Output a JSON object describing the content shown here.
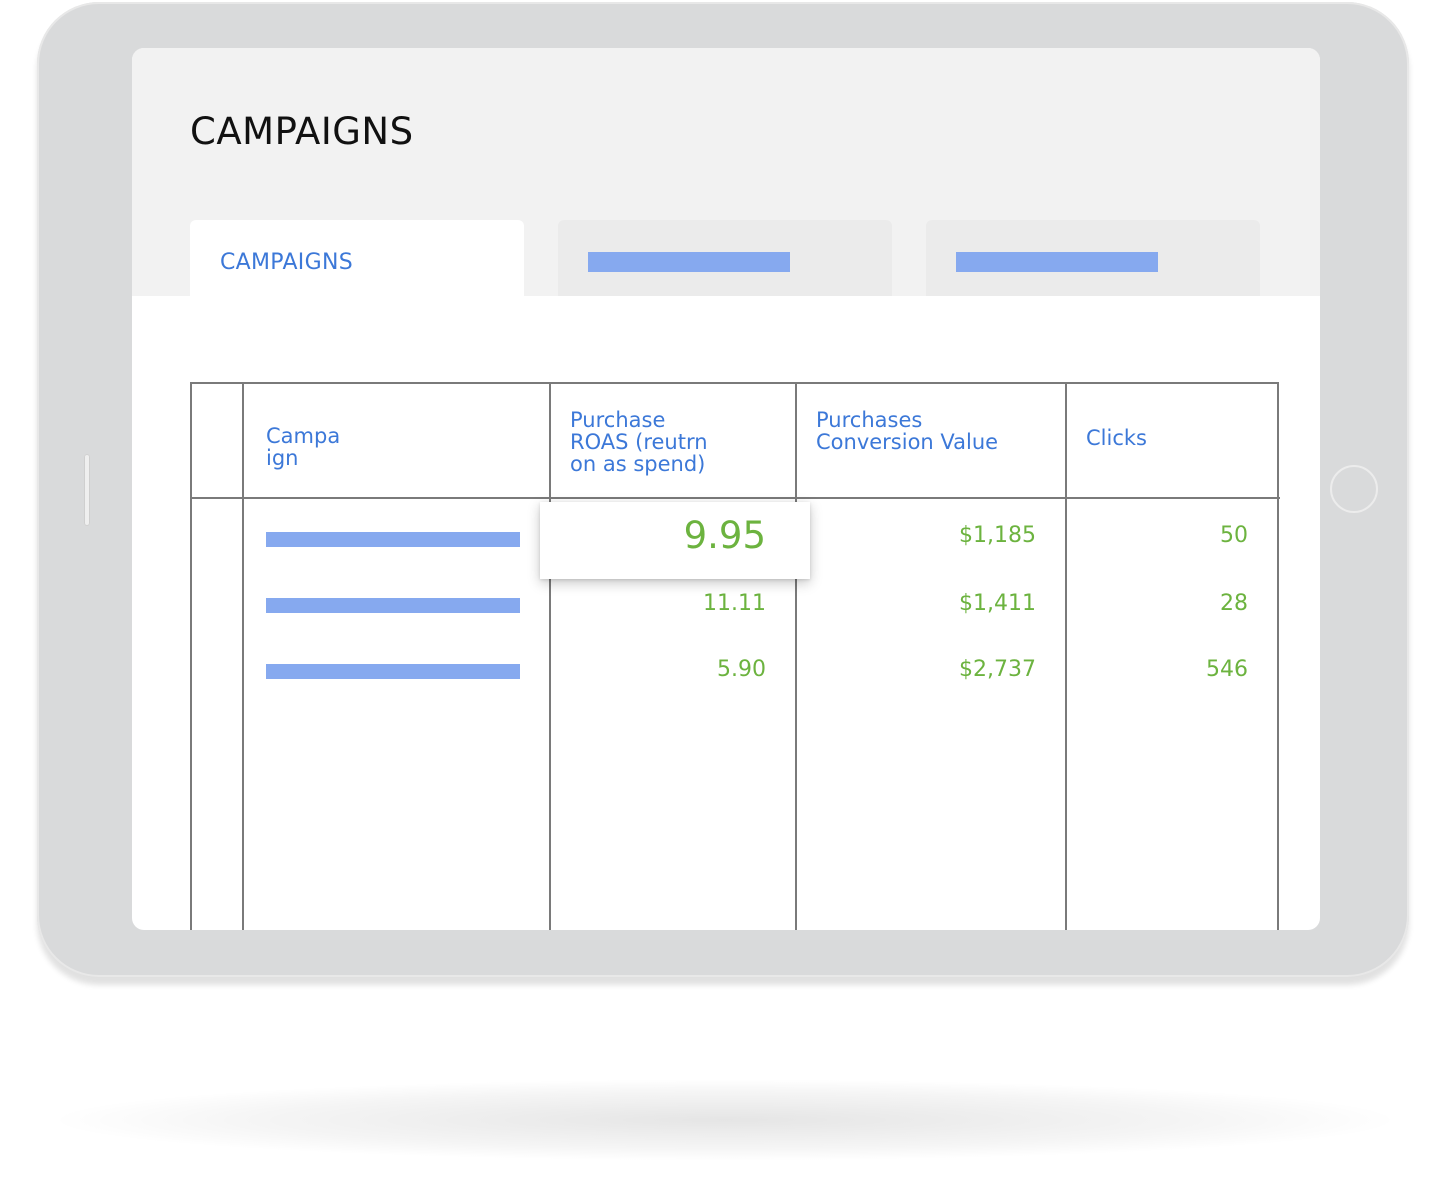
{
  "page": {
    "title": "CAMPAIGNS"
  },
  "tabs": [
    {
      "label": "CAMPAIGNS",
      "active": true
    },
    {
      "label": "",
      "active": false
    },
    {
      "label": "",
      "active": false
    }
  ],
  "table": {
    "columns": [
      {
        "key": "select",
        "label": ""
      },
      {
        "key": "campaign",
        "label_lines": [
          "Campa",
          "ign"
        ]
      },
      {
        "key": "roas",
        "label_lines": [
          "Purchase",
          "ROAS (reutrn",
          "on as spend)"
        ]
      },
      {
        "key": "conversion_value",
        "label_lines": [
          "Purchases",
          "Conversion Value"
        ]
      },
      {
        "key": "clicks",
        "label_lines": [
          "Clicks"
        ]
      }
    ],
    "rows": [
      {
        "campaign": "",
        "roas": "9.95",
        "conversion_value": "$1,185",
        "clicks": "50",
        "highlighted": true
      },
      {
        "campaign": "",
        "roas": "11.11",
        "conversion_value": "$1,411",
        "clicks": "28",
        "highlighted": false
      },
      {
        "campaign": "",
        "roas": "5.90",
        "conversion_value": "$2,737",
        "clicks": "546",
        "highlighted": false
      }
    ]
  },
  "colors": {
    "accent": "#3c78d8",
    "placeholder": "#86a9ef",
    "value": "#6cb33f",
    "device": "#d9dadb",
    "header_bg": "#f2f2f2"
  },
  "icons": {
    "side_button": "tablet-side-button",
    "home_button": "tablet-home-button"
  }
}
